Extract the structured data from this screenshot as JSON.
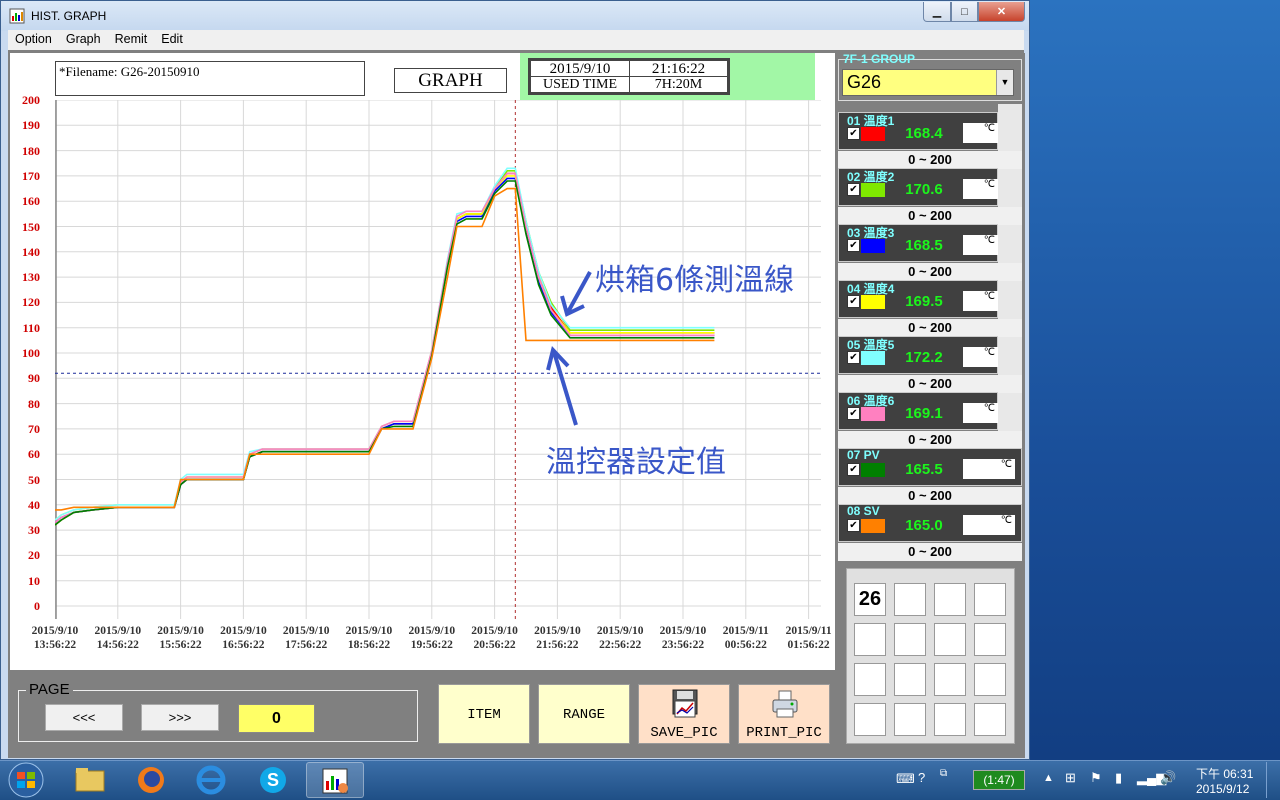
{
  "window": {
    "title": "HIST. GRAPH",
    "min_glyph": "▁",
    "max_glyph": "□",
    "close_glyph": "✕"
  },
  "menu": [
    "Option",
    "Graph",
    "Remit",
    "Edit"
  ],
  "header": {
    "filename": "*Filename: G26-20150910",
    "graph_label": "GRAPH",
    "date": "2015/9/10",
    "time": "21:16:22",
    "used_time_label": "USED TIME",
    "used_time": "7H:20M"
  },
  "annotations": {
    "lines_note": "烘箱6條測溫線",
    "setpoint_note": "溫控器設定值"
  },
  "chart_data": {
    "type": "line",
    "title": "",
    "xlabel": "",
    "ylabel": "",
    "ylim": [
      0,
      200
    ],
    "yticks": [
      "200",
      "190",
      "180",
      "170",
      "160",
      "150",
      "140",
      "130",
      "120",
      "110",
      "100",
      "90",
      "80",
      "70",
      "60",
      "50",
      "40",
      "30",
      "20",
      "10",
      "0"
    ],
    "xtick_labels": [
      [
        "2015/9/10",
        "13:56:22"
      ],
      [
        "2015/9/10",
        "14:56:22"
      ],
      [
        "2015/9/10",
        "15:56:22"
      ],
      [
        "2015/9/10",
        "16:56:22"
      ],
      [
        "2015/9/10",
        "17:56:22"
      ],
      [
        "2015/9/10",
        "18:56:22"
      ],
      [
        "2015/9/10",
        "19:56:22"
      ],
      [
        "2015/9/10",
        "20:56:22"
      ],
      [
        "2015/9/10",
        "21:56:22"
      ],
      [
        "2015/9/10",
        "22:56:22"
      ],
      [
        "2015/9/10",
        "23:56:22"
      ],
      [
        "2015/9/11",
        "00:56:22"
      ],
      [
        "2015/9/11",
        "01:56:22"
      ]
    ],
    "x_hours": [
      0,
      0.1,
      0.3,
      0.6,
      1.0,
      1.9,
      2.0,
      2.1,
      2.3,
      2.9,
      3.0,
      3.1,
      3.3,
      3.9,
      4.0,
      4.1,
      4.3,
      4.9,
      5.0,
      5.2,
      5.4,
      5.7,
      6.0,
      6.25,
      6.4,
      6.55,
      6.8,
      7.0,
      7.2,
      7.33,
      7.5,
      7.7,
      7.9,
      8.2,
      8.5,
      9.0,
      9.5,
      10.0,
      10.5
    ],
    "cursor_hour": 7.33,
    "reference_line": 92,
    "grid": true,
    "series": [
      {
        "values": [
          32,
          34,
          37,
          38,
          39,
          39,
          48,
          50,
          50,
          50,
          50,
          59,
          61,
          61,
          61,
          61,
          61,
          61,
          61,
          70,
          72,
          72,
          100,
          135,
          153,
          155,
          155,
          165,
          171,
          171,
          150,
          130,
          118,
          108,
          108,
          108,
          108,
          108,
          108
        ]
      },
      {
        "values": [
          32,
          34,
          37,
          38,
          39,
          39,
          48,
          50,
          50,
          50,
          50,
          59,
          61,
          61,
          61,
          61,
          61,
          61,
          61,
          70,
          72,
          72,
          100,
          135,
          153,
          155,
          155,
          165,
          172,
          172,
          152,
          132,
          120,
          109,
          109,
          109,
          109,
          109,
          109
        ]
      },
      {
        "values": [
          33,
          35,
          37,
          38,
          39,
          39,
          48,
          50,
          50,
          50,
          50,
          59,
          61,
          61,
          61,
          61,
          61,
          61,
          61,
          70,
          72,
          72,
          100,
          135,
          152,
          154,
          154,
          164,
          169,
          169,
          148,
          128,
          116,
          107,
          107,
          107,
          107,
          107,
          107
        ]
      },
      {
        "values": [
          34,
          36,
          38,
          39,
          40,
          40,
          49,
          51,
          51,
          51,
          51,
          60,
          62,
          62,
          62,
          62,
          62,
          62,
          62,
          71,
          73,
          73,
          101,
          136,
          153,
          155,
          155,
          165,
          170,
          170,
          150,
          130,
          117,
          108,
          108,
          108,
          108,
          108,
          108
        ]
      },
      {
        "values": [
          34,
          36,
          38,
          39,
          40,
          40,
          50,
          52,
          52,
          52,
          52,
          61,
          62,
          62,
          62,
          62,
          62,
          62,
          62,
          71,
          73,
          73,
          101,
          137,
          155,
          156,
          156,
          166,
          173,
          173,
          152,
          132,
          119,
          110,
          110,
          110,
          110,
          110,
          110
        ]
      },
      {
        "values": [
          33,
          35,
          37,
          38,
          39,
          39,
          49,
          51,
          51,
          51,
          51,
          60,
          62,
          62,
          62,
          62,
          62,
          62,
          62,
          71,
          73,
          73,
          101,
          136,
          154,
          156,
          156,
          165,
          171,
          171,
          150,
          130,
          117,
          107,
          107,
          107,
          107,
          107,
          107
        ]
      },
      {
        "values": [
          32,
          34,
          37,
          38,
          39,
          39,
          48,
          50,
          50,
          50,
          50,
          59,
          61,
          61,
          61,
          61,
          61,
          61,
          61,
          70,
          71,
          71,
          99,
          134,
          151,
          153,
          153,
          163,
          168,
          168,
          147,
          127,
          115,
          106,
          106,
          106,
          106,
          106,
          106
        ]
      },
      {
        "values": [
          38,
          38,
          39,
          39,
          39,
          39,
          50,
          50,
          50,
          50,
          50,
          60,
          60,
          60,
          60,
          60,
          60,
          60,
          60,
          70,
          70,
          70,
          98,
          130,
          150,
          150,
          150,
          162,
          165,
          165,
          105,
          105,
          105,
          105,
          105,
          105,
          105,
          105,
          105
        ]
      }
    ]
  },
  "page": {
    "title": "PAGE",
    "prev_label": "<<<",
    "next_label": ">>>",
    "value": "0"
  },
  "buttons": {
    "item": "ITEM",
    "range": "RANGE",
    "save_pic": "SAVE_PIC",
    "print_pic": "PRINT_PIC"
  },
  "group": {
    "title": "7F-1 GROUP",
    "selected": "G26"
  },
  "channels": [
    {
      "name": "01 溫度1",
      "value": "168.4",
      "unit": "℃",
      "range": "0 ~ 200",
      "color": "#ff0000"
    },
    {
      "name": "02 溫度2",
      "value": "170.6",
      "unit": "℃",
      "range": "0 ~ 200",
      "color": "#7fe800"
    },
    {
      "name": "03 溫度3",
      "value": "168.5",
      "unit": "℃",
      "range": "0 ~ 200",
      "color": "#0000ff"
    },
    {
      "name": "04 溫度4",
      "value": "169.5",
      "unit": "℃",
      "range": "0 ~ 200",
      "color": "#ffff00"
    },
    {
      "name": "05 溫度5",
      "value": "172.2",
      "unit": "℃",
      "range": "0 ~ 200",
      "color": "#80ffff"
    },
    {
      "name": "06 溫度6",
      "value": "169.1",
      "unit": "℃",
      "range": "0 ~ 200",
      "color": "#ff80c0"
    },
    {
      "name": "07 PV",
      "value": "165.5",
      "unit": "℃",
      "range": "0 ~ 200",
      "color": "#008000"
    },
    {
      "name": "08 SV",
      "value": "165.0",
      "unit": "℃",
      "range": "0 ~ 200",
      "color": "#ff8000"
    }
  ],
  "grid_cells": [
    "26",
    "",
    "",
    "",
    "",
    "",
    "",
    "",
    "",
    "",
    "",
    "",
    "",
    "",
    "",
    ""
  ],
  "taskbar": {
    "battery_text": "(1:47)",
    "ampm_time": "下午 06:31",
    "date": "2015/9/12"
  }
}
